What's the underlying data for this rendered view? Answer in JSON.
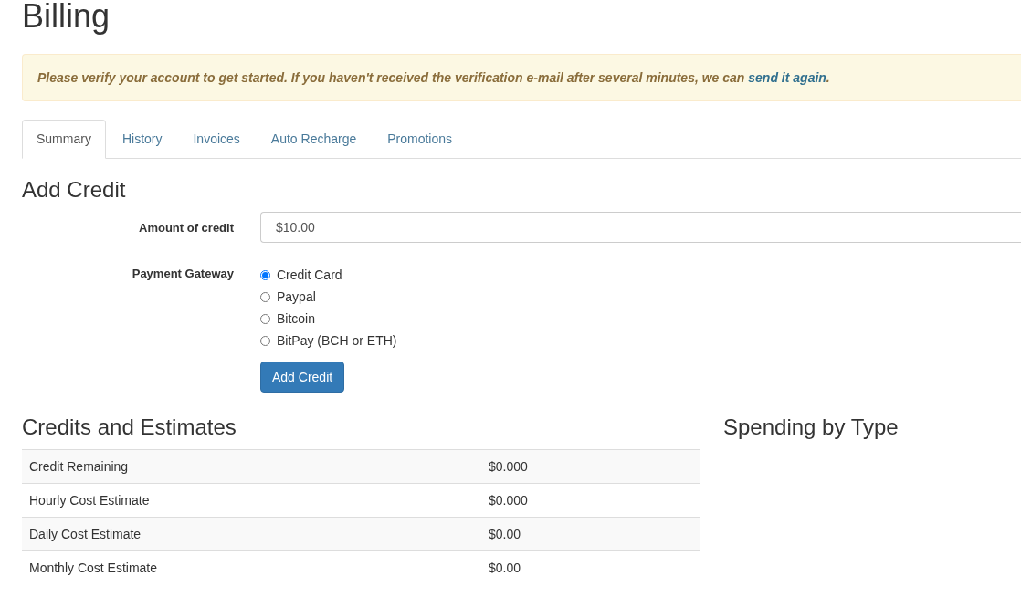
{
  "page_title": "Billing",
  "alert": {
    "message": "Please verify your account to get started. If you haven't received the verification e-mail after several minutes, we can ",
    "link": "send it again",
    "end": "."
  },
  "tabs": [
    {
      "label": "Summary",
      "selected": true
    },
    {
      "label": "History",
      "selected": false
    },
    {
      "label": "Invoices",
      "selected": false
    },
    {
      "label": "Auto Recharge",
      "selected": false
    },
    {
      "label": "Promotions",
      "selected": false
    }
  ],
  "add_credit": {
    "heading": "Add Credit",
    "amount_label": "Amount of credit",
    "amount_value": "$10.00",
    "gateway_label": "Payment Gateway",
    "gateways": [
      {
        "label": "Credit Card",
        "selected": true
      },
      {
        "label": "Paypal",
        "selected": false
      },
      {
        "label": "Bitcoin",
        "selected": false
      },
      {
        "label": "BitPay (BCH or ETH)",
        "selected": false
      }
    ],
    "button": "Add Credit"
  },
  "credits": {
    "heading": "Credits and Estimates",
    "rows": [
      {
        "label": "Credit Remaining",
        "value": "$0.000"
      },
      {
        "label": "Hourly Cost Estimate",
        "value": "$0.000"
      },
      {
        "label": "Daily Cost Estimate",
        "value": "$0.00"
      },
      {
        "label": "Monthly Cost Estimate",
        "value": "$0.00"
      }
    ]
  },
  "spending": {
    "heading": "Spending by Type"
  }
}
